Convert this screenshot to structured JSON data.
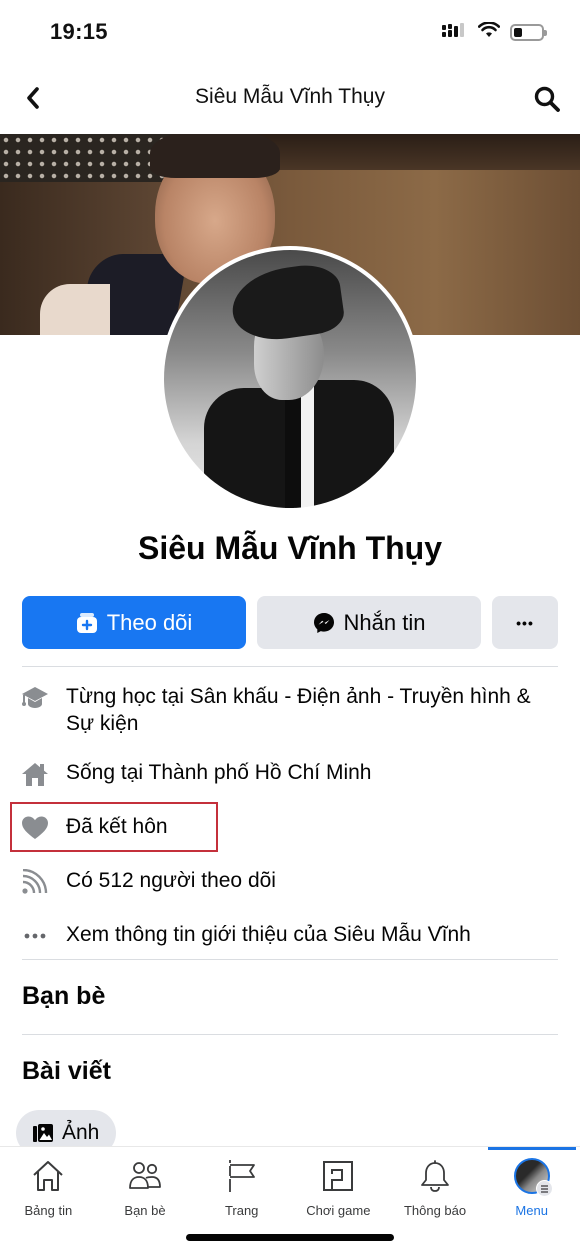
{
  "status_bar": {
    "time": "19:15",
    "battery_level_fraction": 0.3,
    "icons": [
      "cellular-signal-icon",
      "wifi-icon",
      "battery-icon"
    ]
  },
  "nav": {
    "title": "Siêu Mẫu Vĩnh Thụy",
    "back_icon": "chevron-left-icon",
    "search_icon": "search-icon"
  },
  "profile": {
    "name": "Siêu Mẫu Vĩnh Thụy",
    "cover_alt": "cover-photo",
    "avatar_alt": "profile-photo"
  },
  "actions": {
    "follow_label": "Theo dõi",
    "message_label": "Nhắn tin",
    "more_label": "•••"
  },
  "info": {
    "items": [
      {
        "icon": "graduation-cap-icon",
        "text": "Từng học tại Sân khấu - Điện ảnh - Truyền hình & Sự kiện"
      },
      {
        "icon": "home-icon",
        "text": "Sống tại Thành phố Hồ Chí Minh"
      },
      {
        "icon": "heart-icon",
        "text": "Đã kết hôn",
        "highlighted": true
      },
      {
        "icon": "rss-icon",
        "text": "Có 512 người theo dõi"
      },
      {
        "icon": "ellipsis-icon",
        "text": "Xem thông tin giới thiệu của Siêu Mẫu Vĩnh"
      }
    ]
  },
  "sections": {
    "friends_title": "Bạn bè",
    "posts_title": "Bài viết",
    "photos_chip": "Ảnh"
  },
  "tab_bar": {
    "tabs": [
      {
        "label": "Bảng tin",
        "icon": "home-outline-icon"
      },
      {
        "label": "Bạn bè",
        "icon": "friends-icon"
      },
      {
        "label": "Trang",
        "icon": "flag-icon"
      },
      {
        "label": "Chơi game",
        "icon": "gaming-icon"
      },
      {
        "label": "Thông báo",
        "icon": "bell-icon"
      },
      {
        "label": "Menu",
        "icon": "menu-avatar-icon",
        "active": true
      }
    ]
  },
  "colors": {
    "accent": "#1877f2",
    "active_tab": "#1b74e4",
    "button_gray": "#e4e6eb",
    "highlight_border": "#c4303b",
    "icon_gray": "#8a8d91"
  }
}
